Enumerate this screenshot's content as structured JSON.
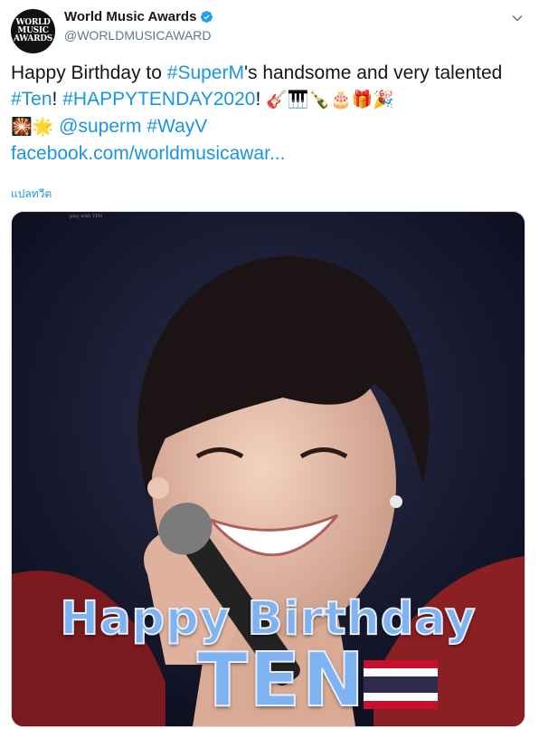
{
  "account": {
    "display_name": "World Music Awards",
    "handle": "@WORLDMUSICAWARD",
    "avatar_lines": [
      "WORLD",
      "MUSIC",
      "AWARDS"
    ],
    "verified": true
  },
  "tweet": {
    "parts": {
      "t1": "Happy Birthday to ",
      "tag_superm": "#SuperM",
      "t2": "'s handsome and very talented ",
      "tag_ten": "#Ten",
      "t3": "! ",
      "tag_happytenday": "#HAPPYTENDAY2020",
      "t4": "! ",
      "emojis_1": "🎸🎹🍾🎂🎁🎉",
      "emojis_2": "🎇🌟",
      "mention_superm": "@superm",
      "tag_wayv": "#WayV",
      "url": "facebook.com/worldmusicawar..."
    },
    "translate_label": "แปลทวีต"
  },
  "media": {
    "small_caption": "play with TEN",
    "overlay_line1": "Happy Birthday",
    "overlay_line2": "TEN",
    "flag": "thailand-flag"
  },
  "colors": {
    "link": "#1b95e0",
    "text": "#14171a",
    "muted": "#657786",
    "verified": "#1da1f2"
  }
}
